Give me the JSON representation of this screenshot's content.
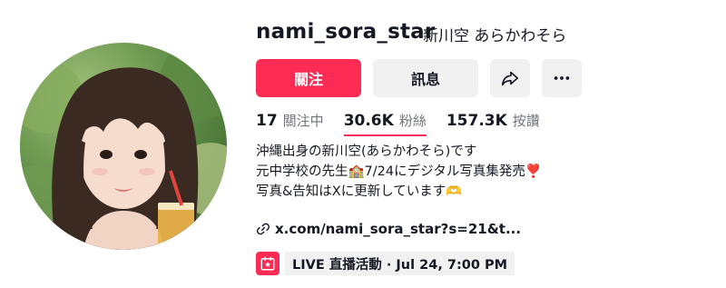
{
  "profile": {
    "username": "nami_sora_star",
    "nickname": "新川空 あらかわそら"
  },
  "actions": {
    "follow_label": "關注",
    "message_label": "訊息",
    "share_icon": "share-icon",
    "more_icon": "more-icon"
  },
  "stats": {
    "following_count": "17",
    "following_label": "關注中",
    "followers_count": "30.6K",
    "followers_label": "粉絲",
    "likes_count": "157.3K",
    "likes_label": "按讚"
  },
  "bio": {
    "lines": [
      "沖縄出身の新川空(あらかわそら)です",
      "元中学校の先生🏫7/24にデジタル写真集発売❣️",
      "写真&告知はXに更新しています🫶"
    ]
  },
  "link": {
    "text": "x.com/nami_sora_star?s=21&t...",
    "icon": "link-icon"
  },
  "live_event": {
    "text": "LIVE 直播活動 · Jul 24, 7:00 PM",
    "icon": "live-event-icon"
  },
  "colors": {
    "accent": "#fe2c55",
    "button_bg": "#f1f1f2",
    "text_primary": "#161823",
    "text_secondary": "#73757c"
  }
}
